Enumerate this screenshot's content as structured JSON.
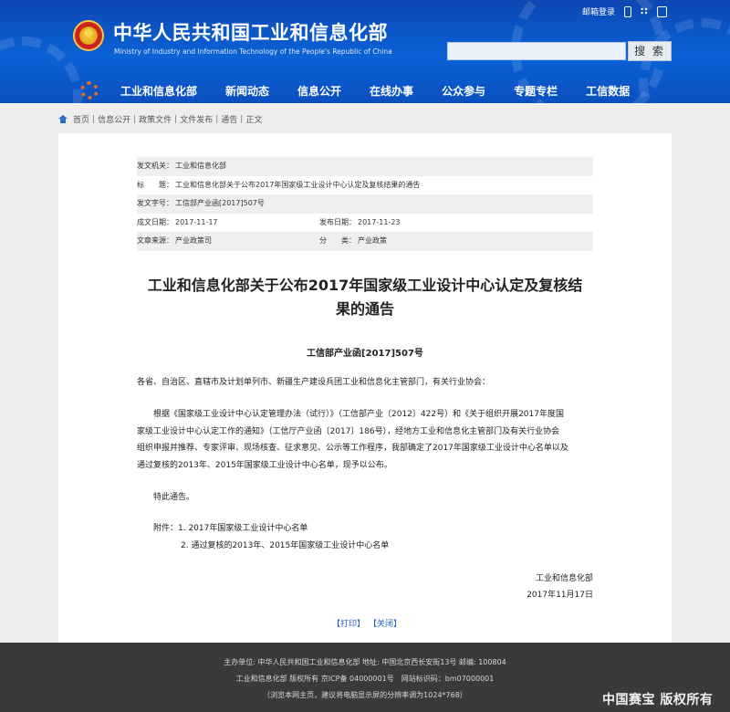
{
  "header": {
    "title": "中华人民共和国工业和信息化部",
    "subtitle": "Ministry of Industry and Information Technology of the People's Republic of China",
    "mail_login": "邮箱登录",
    "search_button": "搜 索",
    "nav": [
      "工业和信息化部",
      "新闻动态",
      "信息公开",
      "在线办事",
      "公众参与",
      "专题专栏",
      "工信数据"
    ]
  },
  "breadcrumb": [
    "首页",
    "信息公开",
    "政策文件",
    "文件发布",
    "通告",
    "正文"
  ],
  "meta": {
    "issuer_label": "发文机关：",
    "issuer": "工业和信息化部",
    "title_label": "标　　题：",
    "title": "工业和信息化部关于公布2017年国家级工业设计中心认定及复核结果的通告",
    "docno_label": "发文字号：",
    "docno": "工信部产业函[2017]507号",
    "created_label": "成文日期：",
    "created": "2017-11-17",
    "published_label": "发布日期：",
    "published": "2017-11-23",
    "source_label": "文章来源：",
    "source": "产业政策司",
    "category_label": "分　　类：",
    "category": "产业政策"
  },
  "article": {
    "title_line1": "工业和信息化部关于公布2017年国家级工业设计中心认定及复核结",
    "title_line2": "果的通告",
    "doc_number": "工信部产业函[2017]507号",
    "salutation": "各省、自治区、直辖市及计划单列市、新疆生产建设兵团工业和信息化主管部门，有关行业协会：",
    "body_lines": [
      "根据《国家级工业设计中心认定管理办法（试行）》（工信部产业〔2012〕422号）和《关于组织开展2017年度国",
      "家级工业设计中心认定工作的通知》（工信厅产业函〔2017〕186号），经地方工业和信息化主管部门及有关行业协会",
      "组织申报并推荐、专家评审、现场核查、征求意见、公示等工作程序，我部确定了2017年国家级工业设计中心名单以及",
      "通过复核的2013年、2015年国家级工业设计中心名单，现予以公布。"
    ],
    "special_notice": "特此通告。",
    "attachment_1": "附件：1. 2017年国家级工业设计中心名单",
    "attachment_2": "2. 通过复核的2013年、2015年国家级工业设计中心名单",
    "signer": "工业和信息化部",
    "sign_date": "2017年11月17日",
    "print_label": "【打印】",
    "close_label": "【关闭】"
  },
  "footer": {
    "line1": "主办单位: 中华人民共和国工业和信息化部 地址: 中国北京西长安街13号 邮编: 100804",
    "line2": "工业和信息化部 版权所有 京ICP备 04000001号　网站标识码：bm07000001",
    "line3": "（浏览本网主页，建议将电脑显示屏的分辨率调为1024*768）",
    "watermark": "中国赛宝 版权所有"
  }
}
